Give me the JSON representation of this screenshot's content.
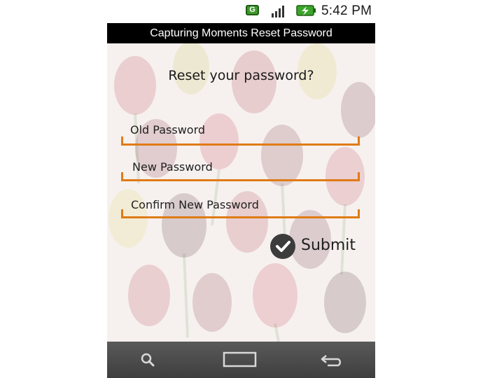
{
  "status_bar": {
    "network_badge": "G",
    "icons": [
      "g-network-icon",
      "signal-icon",
      "battery-charging-icon"
    ],
    "time": "5:42 PM"
  },
  "app": {
    "title": "Capturing Moments Reset Password"
  },
  "form": {
    "heading": "Reset your password?",
    "fields": [
      {
        "label": "Old Password",
        "value": ""
      },
      {
        "label": "New Password",
        "value": ""
      },
      {
        "label": "Confirm New Password",
        "value": ""
      }
    ],
    "submit": {
      "label": "Submit",
      "icon": "checkmark-icon"
    }
  },
  "nav_bar": {
    "buttons": [
      "search-icon",
      "home-icon",
      "back-icon"
    ]
  },
  "colors": {
    "accent": "#e07b16",
    "title_bar": "#000000",
    "nav_bar": "#4a4a4a",
    "submit_icon": "#3c3c3c"
  }
}
